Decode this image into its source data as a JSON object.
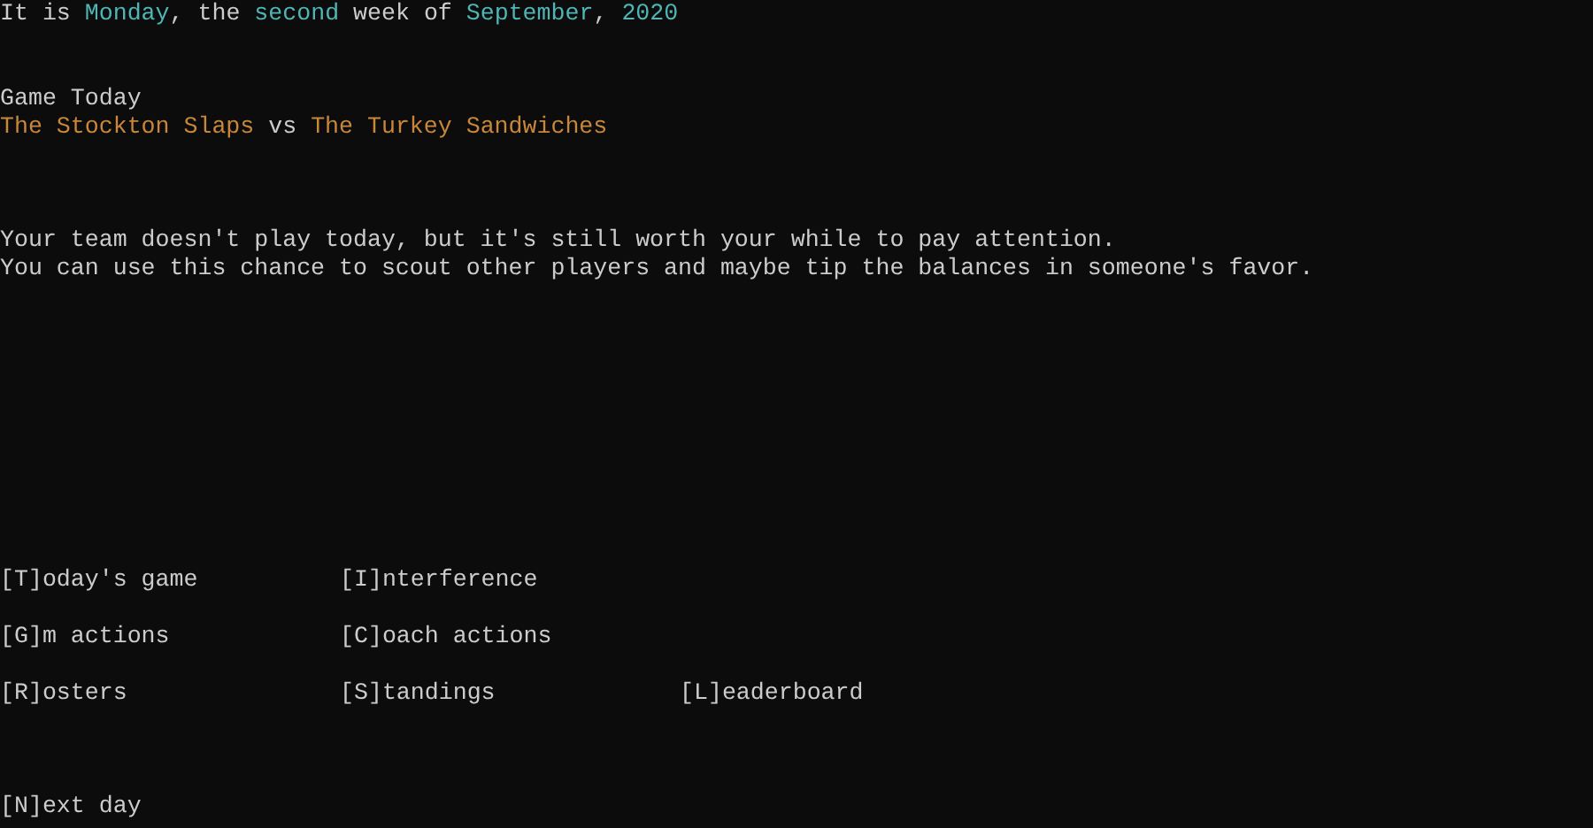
{
  "date_line": [
    {
      "text": "It is ",
      "kind": "plain"
    },
    {
      "text": "Monday",
      "kind": "highlight"
    },
    {
      "text": ", the ",
      "kind": "plain"
    },
    {
      "text": "second",
      "kind": "highlight"
    },
    {
      "text": " week of ",
      "kind": "plain"
    },
    {
      "text": "September",
      "kind": "highlight"
    },
    {
      "text": ", ",
      "kind": "plain"
    },
    {
      "text": "2020",
      "kind": "highlight"
    }
  ],
  "game": {
    "heading": "Game Today",
    "matchup": [
      {
        "text": "The Stockton Slaps",
        "kind": "team"
      },
      {
        "text": " vs ",
        "kind": "plain"
      },
      {
        "text": "The Turkey Sandwiches",
        "kind": "team"
      }
    ]
  },
  "message": [
    "Your team doesn't play today, but it's still worth your while to pay attention.",
    "You can use this chance to scout other players and maybe tip the balances in someone's favor."
  ],
  "menu": [
    [
      "[T]oday's game",
      "[I]nterference"
    ],
    [
      "[G]m actions",
      "[C]oach actions"
    ],
    [
      "[R]osters",
      "[S]tandings",
      "[L]eaderboard"
    ]
  ],
  "next": "[N]ext day"
}
